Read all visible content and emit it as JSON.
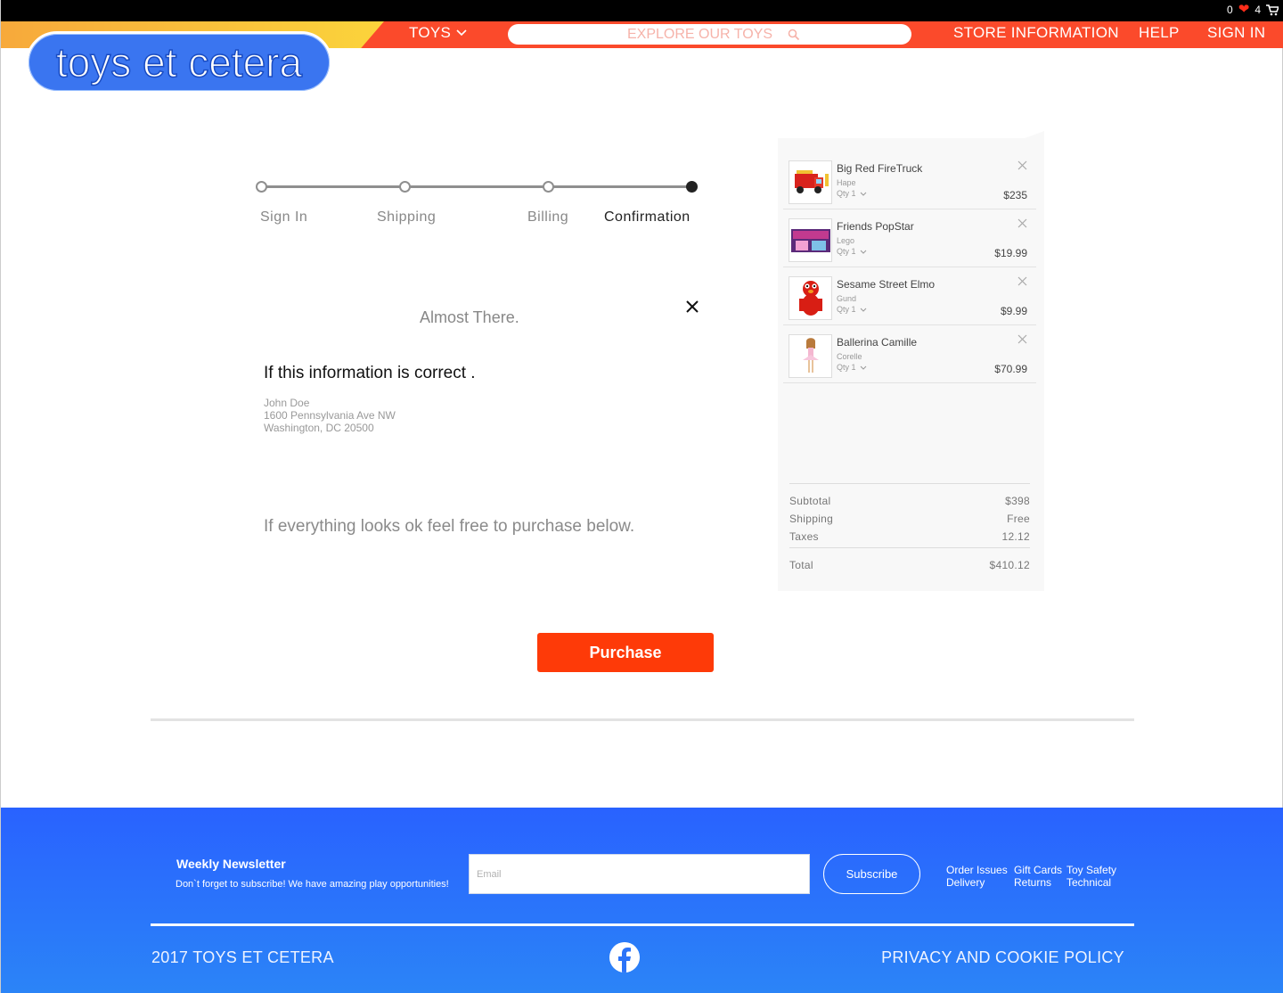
{
  "top_strip": {
    "likes_left": "0",
    "heart_icon": "heart-icon",
    "likes_right": "4",
    "cart_icon": "cart-icon"
  },
  "nav": {
    "toys_label": "TOYS",
    "search_placeholder": "EXPLORE OUR TOYS",
    "store_label": "STORE INFORMATION",
    "help_label": "HELP",
    "signin_label": "SIGN IN"
  },
  "logo": {
    "text": "toys et cetera"
  },
  "stepper": {
    "steps": [
      "Sign In",
      "Shipping",
      "Billing",
      "Confirmation"
    ],
    "active_step": 4
  },
  "confirm": {
    "heading": "Almost There.",
    "info_title": "If this information is correct .",
    "address": [
      "John Doe",
      "1600 Pennsylvania Ave NW",
      "Washington, DC 20500"
    ],
    "note": "If everything looks ok feel free to purchase below."
  },
  "cart": {
    "items": [
      {
        "name": "Big Red FireTruck",
        "brand": "Hape",
        "qty": "Qty 1",
        "price": "$235"
      },
      {
        "name": "Friends PopStar",
        "brand": "Lego",
        "qty": "Qty 1",
        "price": "$19.99"
      },
      {
        "name": "Sesame Street Elmo",
        "brand": "Gund",
        "qty": "Qty 1",
        "price": "$9.99"
      },
      {
        "name": "Ballerina Camille",
        "brand": "Corelle",
        "qty": "Qty 1",
        "price": "$70.99"
      }
    ],
    "subtotal_label": "Subtotal",
    "subtotal": "$398",
    "shipping_label": "Shipping",
    "shipping": "Free",
    "taxes_label": "Taxes",
    "taxes": "12.12",
    "total_label": "Total",
    "total": "$410.12"
  },
  "purchase_label": "Purchase",
  "footer": {
    "newsletter_title": "Weekly Newsletter",
    "newsletter_sub": "Don`t forget to subscribe! We have amazing play opportunities!",
    "email_placeholder": "Email",
    "subscribe_label": "Subscribe",
    "links_col1": [
      "Order Issues",
      "Delivery"
    ],
    "links_col2": [
      "Gift Cards",
      "Returns"
    ],
    "links_col3": [
      "Toy Safety",
      "Technical"
    ],
    "copyright": "2017 TOYS ET CETERA",
    "privacy": "PRIVACY AND COOKIE POLICY"
  },
  "colors": {
    "nav_red": "#fb4a2b",
    "purchase": "#fe3a08",
    "footer_blue": "#2962ff",
    "logo_blue": "#3a75f0"
  }
}
